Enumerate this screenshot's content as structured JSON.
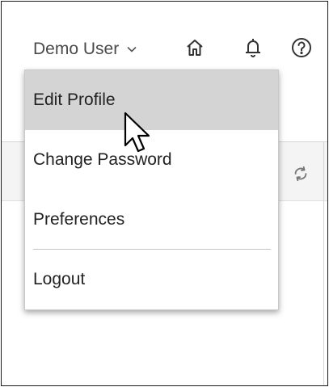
{
  "header": {
    "user_name": "Demo User",
    "chevron_icon": "chevron-down-icon",
    "home_icon": "home-icon",
    "bell_icon": "bell-icon",
    "help_icon": "help-icon"
  },
  "panel": {
    "refresh_icon": "refresh-icon"
  },
  "user_menu": {
    "items": [
      {
        "label": "Edit Profile",
        "hovered": true
      },
      {
        "label": "Change Password",
        "hovered": false
      },
      {
        "label": "Preferences",
        "hovered": false
      },
      {
        "label": "Logout",
        "hovered": false
      }
    ]
  },
  "colors": {
    "hover_bg": "#d4d4d4",
    "text": "#222222",
    "muted_text": "#4a4a4a"
  }
}
